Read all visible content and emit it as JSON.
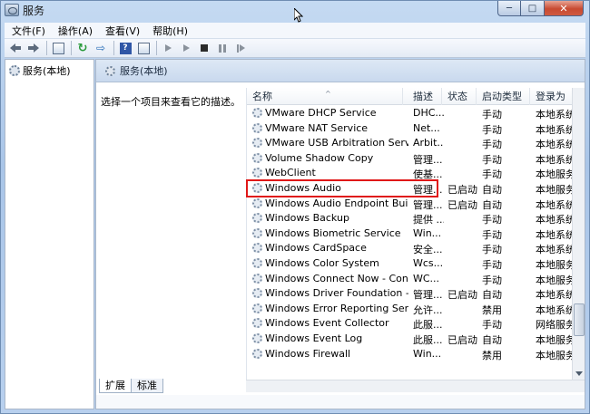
{
  "window": {
    "title": "服务",
    "caption": {
      "minimize": "─",
      "maximize": "□",
      "close": "✕"
    }
  },
  "menu": [
    "文件(F)",
    "操作(A)",
    "查看(V)",
    "帮助(H)"
  ],
  "toolbar": {
    "icons": [
      "back-arrow-icon",
      "forward-arrow-icon",
      "console-tree-icon",
      "refresh-icon",
      "export-icon",
      "help-icon",
      "properties-icon",
      "start-service-icon",
      "start-service-alt-icon",
      "stop-service-icon",
      "pause-service-icon",
      "restart-service-icon"
    ]
  },
  "tree": {
    "root_label": "服务(本地)"
  },
  "pane": {
    "header_title": "服务(本地)",
    "description_hint": "选择一个项目来查看它的描述。",
    "columns": [
      "名称",
      "描述",
      "状态",
      "启动类型",
      "登录为"
    ],
    "rows": [
      {
        "name": "VMware DHCP Service",
        "desc": "DHC...",
        "status": "",
        "startup": "手动",
        "logon": "本地系统"
      },
      {
        "name": "VMware NAT Service",
        "desc": "Net...",
        "status": "",
        "startup": "手动",
        "logon": "本地系统"
      },
      {
        "name": "VMware USB Arbitration Service",
        "desc": "Arbit...",
        "status": "",
        "startup": "手动",
        "logon": "本地系统"
      },
      {
        "name": "Volume Shadow Copy",
        "desc": "管理...",
        "status": "",
        "startup": "手动",
        "logon": "本地系统"
      },
      {
        "name": "WebClient",
        "desc": "使基...",
        "status": "",
        "startup": "手动",
        "logon": "本地服务"
      },
      {
        "name": "Windows Audio",
        "desc": "管理...",
        "status": "已启动",
        "startup": "自动",
        "logon": "本地服务"
      },
      {
        "name": "Windows Audio Endpoint Builder",
        "desc": "管理...",
        "status": "已启动",
        "startup": "自动",
        "logon": "本地系统"
      },
      {
        "name": "Windows Backup",
        "desc": "提供 ...",
        "status": "",
        "startup": "手动",
        "logon": "本地系统"
      },
      {
        "name": "Windows Biometric Service",
        "desc": "Win...",
        "status": "",
        "startup": "手动",
        "logon": "本地系统"
      },
      {
        "name": "Windows CardSpace",
        "desc": "安全...",
        "status": "",
        "startup": "手动",
        "logon": "本地系统"
      },
      {
        "name": "Windows Color System",
        "desc": "Wcs...",
        "status": "",
        "startup": "手动",
        "logon": "本地服务"
      },
      {
        "name": "Windows Connect Now - Config...",
        "desc": "WC...",
        "status": "",
        "startup": "手动",
        "logon": "本地服务"
      },
      {
        "name": "Windows Driver Foundation - U...",
        "desc": "管理...",
        "status": "已启动",
        "startup": "自动",
        "logon": "本地系统"
      },
      {
        "name": "Windows Error Reporting Service",
        "desc": "允许...",
        "status": "",
        "startup": "禁用",
        "logon": "本地系统"
      },
      {
        "name": "Windows Event Collector",
        "desc": "此服...",
        "status": "",
        "startup": "手动",
        "logon": "网络服务"
      },
      {
        "name": "Windows Event Log",
        "desc": "此服...",
        "status": "已启动",
        "startup": "自动",
        "logon": "本地服务"
      },
      {
        "name": "Windows Firewall",
        "desc": "Win...",
        "status": "",
        "startup": "禁用",
        "logon": "本地服务"
      }
    ]
  },
  "tabs": [
    "扩展",
    "标准"
  ],
  "colors": {
    "highlight": "#e01818",
    "accent": "#2f56a6"
  }
}
